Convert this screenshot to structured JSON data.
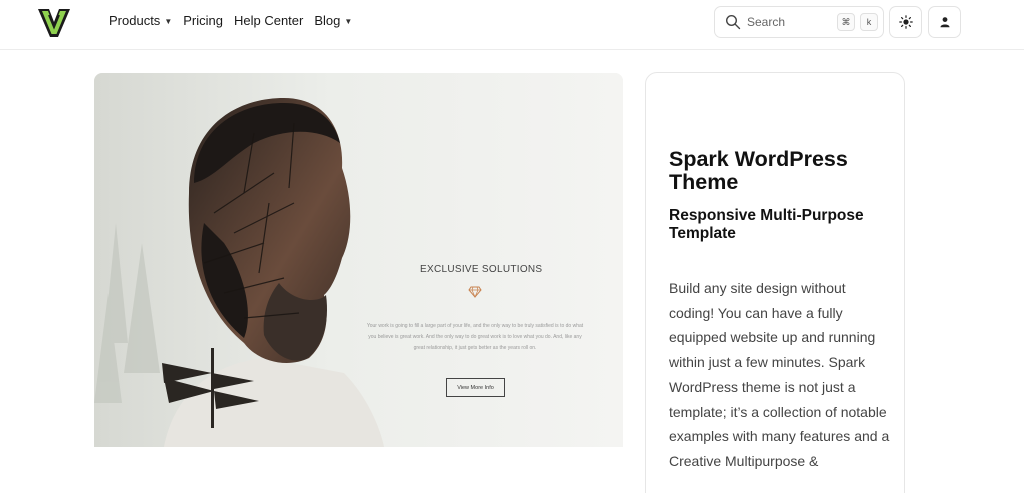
{
  "header": {
    "logo_icon": "v-logo-icon",
    "nav": [
      {
        "label": "Products",
        "has_dropdown": true
      },
      {
        "label": "Pricing",
        "has_dropdown": false
      },
      {
        "label": "Help Center",
        "has_dropdown": false
      },
      {
        "label": "Blog",
        "has_dropdown": true
      }
    ],
    "search": {
      "label": "Search",
      "shortcut_keys": [
        "⌘",
        "k"
      ]
    },
    "theme_toggle_icon": "sun-icon",
    "user_icon": "user-icon"
  },
  "hero": {
    "title": "EXCLUSIVE SOLUTIONS",
    "body": "Your work is going to fill a large part of your life, and the only way to be truly satisfied is to do what you believe is great work. And the only way to do great work is to love what you do. And, like any great relationship, it just gets better as the years roll on.",
    "button_label": "View More Info"
  },
  "product": {
    "title": "Spark WordPress Theme",
    "subtitle": "Responsive Multi-Purpose Template",
    "description": "Build any site design without coding! You can have a fully equipped website up and running within just a few minutes. Spark WordPress theme is not just a template; it’s a collection of notable examples with many features and a Creative Multipurpose &"
  },
  "colors": {
    "logo_green": "#8fd14f",
    "border": "#e6e6e6",
    "text_dark": "#111111",
    "text_muted": "#444444"
  }
}
